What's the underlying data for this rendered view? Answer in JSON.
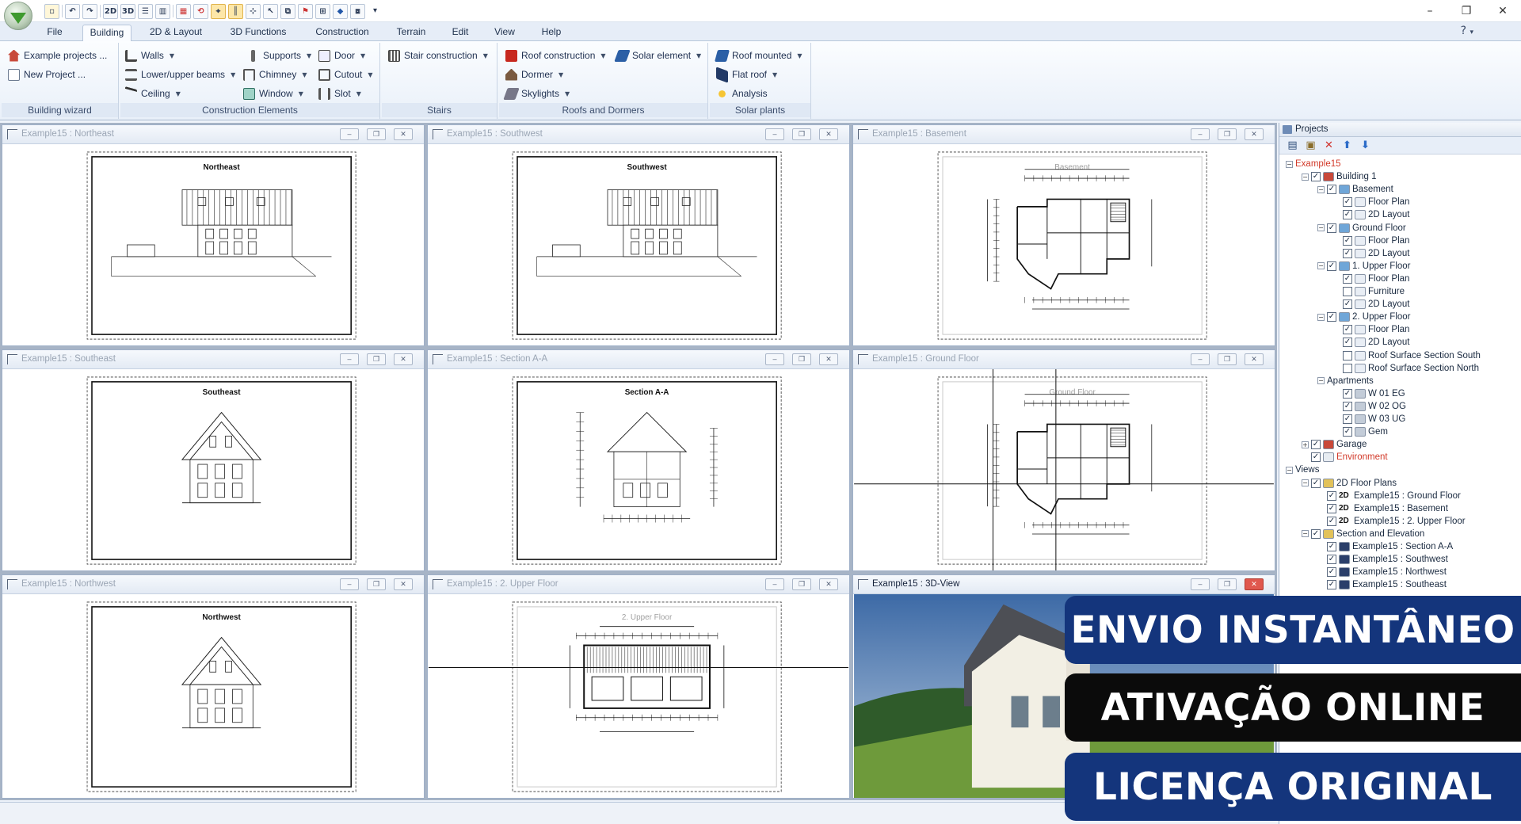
{
  "window": {
    "minimize": "–",
    "maximize": "❐",
    "close": "✕"
  },
  "menu": {
    "tabs": [
      {
        "label": "File",
        "active": false
      },
      {
        "label": "Building",
        "active": true
      },
      {
        "label": "2D & Layout",
        "active": false
      },
      {
        "label": "3D Functions",
        "active": false
      },
      {
        "label": "Construction",
        "active": false
      },
      {
        "label": "Terrain",
        "active": false
      },
      {
        "label": "Edit",
        "active": false
      },
      {
        "label": "View",
        "active": false
      },
      {
        "label": "Help",
        "active": false
      }
    ],
    "help_icon": "?"
  },
  "qat": {
    "labels": [
      "2D",
      "3D"
    ]
  },
  "ribbon": {
    "groups": [
      {
        "label": "Building wizard",
        "items": [
          {
            "label": "Example projects ...",
            "icon": "house-icon"
          },
          {
            "label": "New Project ...",
            "icon": "new-document-icon"
          }
        ]
      },
      {
        "label": "Construction Elements",
        "items": [
          {
            "label": "Walls",
            "icon": "wall-icon"
          },
          {
            "label": "Lower/upper beams",
            "icon": "beam-icon"
          },
          {
            "label": "Ceiling",
            "icon": "ceiling-icon"
          },
          {
            "label": "Supports",
            "icon": "support-icon"
          },
          {
            "label": "Chimney",
            "icon": "chimney-icon"
          },
          {
            "label": "Window",
            "icon": "window-icon"
          },
          {
            "label": "Door",
            "icon": "door-icon"
          },
          {
            "label": "Cutout",
            "icon": "cutout-icon"
          },
          {
            "label": "Slot",
            "icon": "slot-icon"
          }
        ]
      },
      {
        "label": "Stairs",
        "items": [
          {
            "label": "Stair construction",
            "icon": "stair-icon"
          }
        ]
      },
      {
        "label": "Roofs and Dormers",
        "items": [
          {
            "label": "Roof construction",
            "icon": "roof-icon"
          },
          {
            "label": "Dormer",
            "icon": "dormer-icon"
          },
          {
            "label": "Skylights",
            "icon": "skylight-icon"
          },
          {
            "label": "Solar element",
            "icon": "solar-element-icon"
          }
        ]
      },
      {
        "label": "Solar plants",
        "items": [
          {
            "label": "Roof mounted",
            "icon": "solar-panel-icon"
          },
          {
            "label": "Flat roof",
            "icon": "flat-roof-icon"
          },
          {
            "label": "Analysis",
            "icon": "analysis-icon"
          }
        ]
      }
    ]
  },
  "views": [
    {
      "title": "Example15 : Northeast",
      "sheet": "Northeast",
      "active": false
    },
    {
      "title": "Example15 : Southwest",
      "sheet": "Southwest",
      "active": false
    },
    {
      "title": "Example15 : Basement",
      "sheet": "Basement",
      "active": false
    },
    {
      "title": "Example15 : Southeast",
      "sheet": "Southeast",
      "active": false
    },
    {
      "title": "Example15 : Section A-A",
      "sheet": "Section A-A",
      "active": false
    },
    {
      "title": "Example15 : Ground Floor",
      "sheet": "Ground Floor",
      "active": false
    },
    {
      "title": "Example15 : Northwest",
      "sheet": "Northwest",
      "active": false
    },
    {
      "title": "Example15 : 2. Upper Floor",
      "sheet": "2. Upper Floor",
      "active": false
    },
    {
      "title": "Example15 : 3D-View",
      "sheet": "",
      "active": true
    }
  ],
  "view_buttons": {
    "min": "–",
    "max": "❐",
    "close": "✕"
  },
  "panel": {
    "title": "Projects",
    "tree": [
      {
        "label": "Example15",
        "level": 0,
        "toggle": "−",
        "checkbox": null,
        "color": "#d23a2a"
      },
      {
        "label": "Building 1",
        "level": 1,
        "toggle": "−",
        "checkbox": "✓",
        "icon": "building-icon"
      },
      {
        "label": "Basement",
        "level": 2,
        "toggle": "−",
        "checkbox": "✓",
        "icon": "floor-icon"
      },
      {
        "label": "Floor Plan",
        "level": 3,
        "toggle": null,
        "checkbox": "✓",
        "icon": "sheet-icon"
      },
      {
        "label": "2D Layout",
        "level": 3,
        "toggle": null,
        "checkbox": "✓",
        "icon": "sheet-icon"
      },
      {
        "label": "Ground Floor",
        "level": 2,
        "toggle": "−",
        "checkbox": "✓",
        "icon": "floor-icon"
      },
      {
        "label": "Floor Plan",
        "level": 3,
        "toggle": null,
        "checkbox": "✓",
        "icon": "sheet-icon"
      },
      {
        "label": "2D Layout",
        "level": 3,
        "toggle": null,
        "checkbox": "✓",
        "icon": "sheet-icon"
      },
      {
        "label": "1. Upper Floor",
        "level": 2,
        "toggle": "−",
        "checkbox": "✓",
        "icon": "floor-icon"
      },
      {
        "label": "Floor Plan",
        "level": 3,
        "toggle": null,
        "checkbox": "✓",
        "icon": "sheet-icon"
      },
      {
        "label": "Furniture",
        "level": 3,
        "toggle": null,
        "checkbox": "",
        "icon": "sheet-icon"
      },
      {
        "label": "2D Layout",
        "level": 3,
        "toggle": null,
        "checkbox": "✓",
        "icon": "sheet-icon"
      },
      {
        "label": "2. Upper Floor",
        "level": 2,
        "toggle": "−",
        "checkbox": "✓",
        "icon": "floor-icon"
      },
      {
        "label": "Floor Plan",
        "level": 3,
        "toggle": null,
        "checkbox": "✓",
        "icon": "sheet-icon"
      },
      {
        "label": "2D Layout",
        "level": 3,
        "toggle": null,
        "checkbox": "✓",
        "icon": "sheet-icon"
      },
      {
        "label": "Roof Surface Section South",
        "level": 3,
        "toggle": null,
        "checkbox": "",
        "icon": "sheet-icon"
      },
      {
        "label": "Roof Surface Section North",
        "level": 3,
        "toggle": null,
        "checkbox": "",
        "icon": "sheet-icon"
      },
      {
        "label": "Apartments",
        "level": 2,
        "toggle": "−",
        "checkbox": null,
        "icon": null
      },
      {
        "label": "W 01 EG",
        "level": 3,
        "toggle": null,
        "checkbox": "✓",
        "icon": "apartment-icon"
      },
      {
        "label": "W 02 OG",
        "level": 3,
        "toggle": null,
        "checkbox": "✓",
        "icon": "apartment-icon"
      },
      {
        "label": "W 03 UG",
        "level": 3,
        "toggle": null,
        "checkbox": "✓",
        "icon": "apartment-icon"
      },
      {
        "label": "Gem",
        "level": 3,
        "toggle": null,
        "checkbox": "✓",
        "icon": "apartment-icon"
      },
      {
        "label": "Garage",
        "level": 1,
        "toggle": "+",
        "checkbox": "✓",
        "icon": "building-icon"
      },
      {
        "label": "Environment",
        "level": 1,
        "toggle": null,
        "checkbox": "✓",
        "icon": "environment-icon",
        "color": "#d23a2a"
      },
      {
        "label": "Views",
        "level": 0,
        "toggle": "−",
        "checkbox": null,
        "icon": null
      },
      {
        "label": "2D Floor Plans",
        "level": 1,
        "toggle": "−",
        "checkbox": "✓",
        "icon": "folder-icon"
      },
      {
        "label": "Example15 : Ground Floor",
        "level": 2,
        "toggle": null,
        "checkbox": "✓",
        "icon": "2d-icon"
      },
      {
        "label": "Example15 : Basement",
        "level": 2,
        "toggle": null,
        "checkbox": "✓",
        "icon": "2d-icon"
      },
      {
        "label": "Example15 : 2. Upper Floor",
        "level": 2,
        "toggle": null,
        "checkbox": "✓",
        "icon": "2d-icon"
      },
      {
        "label": "Section and Elevation",
        "level": 1,
        "toggle": "−",
        "checkbox": "✓",
        "icon": "folder-icon"
      },
      {
        "label": "Example15 : Section A-A",
        "level": 2,
        "toggle": null,
        "checkbox": "✓",
        "icon": "section-icon"
      },
      {
        "label": "Example15 : Southwest",
        "level": 2,
        "toggle": null,
        "checkbox": "✓",
        "icon": "section-icon"
      },
      {
        "label": "Example15 : Northwest",
        "level": 2,
        "toggle": null,
        "checkbox": "✓",
        "icon": "section-icon"
      },
      {
        "label": "Example15 : Southeast",
        "level": 2,
        "toggle": null,
        "checkbox": "✓",
        "icon": "section-icon"
      }
    ]
  },
  "promo": {
    "line1": "ENVIO INSTANTÂNEO",
    "line2": "ATIVAÇÃO ONLINE",
    "line3": "LICENÇA ORIGINAL"
  },
  "colors": {
    "banner_blue": "#14357c",
    "banner_black": "#0b0b0b",
    "accent_red": "#d23a2a"
  }
}
